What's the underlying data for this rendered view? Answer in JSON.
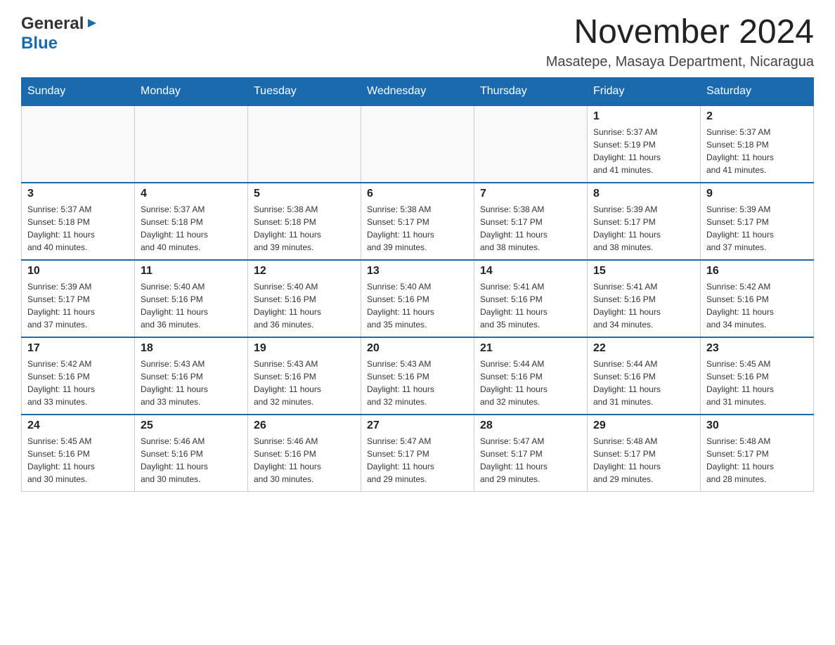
{
  "header": {
    "logo_general": "General",
    "logo_blue": "Blue",
    "title": "November 2024",
    "subtitle": "Masatepe, Masaya Department, Nicaragua"
  },
  "calendar": {
    "days_of_week": [
      "Sunday",
      "Monday",
      "Tuesday",
      "Wednesday",
      "Thursday",
      "Friday",
      "Saturday"
    ],
    "weeks": [
      [
        {
          "day": "",
          "info": ""
        },
        {
          "day": "",
          "info": ""
        },
        {
          "day": "",
          "info": ""
        },
        {
          "day": "",
          "info": ""
        },
        {
          "day": "",
          "info": ""
        },
        {
          "day": "1",
          "info": "Sunrise: 5:37 AM\nSunset: 5:19 PM\nDaylight: 11 hours\nand 41 minutes."
        },
        {
          "day": "2",
          "info": "Sunrise: 5:37 AM\nSunset: 5:18 PM\nDaylight: 11 hours\nand 41 minutes."
        }
      ],
      [
        {
          "day": "3",
          "info": "Sunrise: 5:37 AM\nSunset: 5:18 PM\nDaylight: 11 hours\nand 40 minutes."
        },
        {
          "day": "4",
          "info": "Sunrise: 5:37 AM\nSunset: 5:18 PM\nDaylight: 11 hours\nand 40 minutes."
        },
        {
          "day": "5",
          "info": "Sunrise: 5:38 AM\nSunset: 5:18 PM\nDaylight: 11 hours\nand 39 minutes."
        },
        {
          "day": "6",
          "info": "Sunrise: 5:38 AM\nSunset: 5:17 PM\nDaylight: 11 hours\nand 39 minutes."
        },
        {
          "day": "7",
          "info": "Sunrise: 5:38 AM\nSunset: 5:17 PM\nDaylight: 11 hours\nand 38 minutes."
        },
        {
          "day": "8",
          "info": "Sunrise: 5:39 AM\nSunset: 5:17 PM\nDaylight: 11 hours\nand 38 minutes."
        },
        {
          "day": "9",
          "info": "Sunrise: 5:39 AM\nSunset: 5:17 PM\nDaylight: 11 hours\nand 37 minutes."
        }
      ],
      [
        {
          "day": "10",
          "info": "Sunrise: 5:39 AM\nSunset: 5:17 PM\nDaylight: 11 hours\nand 37 minutes."
        },
        {
          "day": "11",
          "info": "Sunrise: 5:40 AM\nSunset: 5:16 PM\nDaylight: 11 hours\nand 36 minutes."
        },
        {
          "day": "12",
          "info": "Sunrise: 5:40 AM\nSunset: 5:16 PM\nDaylight: 11 hours\nand 36 minutes."
        },
        {
          "day": "13",
          "info": "Sunrise: 5:40 AM\nSunset: 5:16 PM\nDaylight: 11 hours\nand 35 minutes."
        },
        {
          "day": "14",
          "info": "Sunrise: 5:41 AM\nSunset: 5:16 PM\nDaylight: 11 hours\nand 35 minutes."
        },
        {
          "day": "15",
          "info": "Sunrise: 5:41 AM\nSunset: 5:16 PM\nDaylight: 11 hours\nand 34 minutes."
        },
        {
          "day": "16",
          "info": "Sunrise: 5:42 AM\nSunset: 5:16 PM\nDaylight: 11 hours\nand 34 minutes."
        }
      ],
      [
        {
          "day": "17",
          "info": "Sunrise: 5:42 AM\nSunset: 5:16 PM\nDaylight: 11 hours\nand 33 minutes."
        },
        {
          "day": "18",
          "info": "Sunrise: 5:43 AM\nSunset: 5:16 PM\nDaylight: 11 hours\nand 33 minutes."
        },
        {
          "day": "19",
          "info": "Sunrise: 5:43 AM\nSunset: 5:16 PM\nDaylight: 11 hours\nand 32 minutes."
        },
        {
          "day": "20",
          "info": "Sunrise: 5:43 AM\nSunset: 5:16 PM\nDaylight: 11 hours\nand 32 minutes."
        },
        {
          "day": "21",
          "info": "Sunrise: 5:44 AM\nSunset: 5:16 PM\nDaylight: 11 hours\nand 32 minutes."
        },
        {
          "day": "22",
          "info": "Sunrise: 5:44 AM\nSunset: 5:16 PM\nDaylight: 11 hours\nand 31 minutes."
        },
        {
          "day": "23",
          "info": "Sunrise: 5:45 AM\nSunset: 5:16 PM\nDaylight: 11 hours\nand 31 minutes."
        }
      ],
      [
        {
          "day": "24",
          "info": "Sunrise: 5:45 AM\nSunset: 5:16 PM\nDaylight: 11 hours\nand 30 minutes."
        },
        {
          "day": "25",
          "info": "Sunrise: 5:46 AM\nSunset: 5:16 PM\nDaylight: 11 hours\nand 30 minutes."
        },
        {
          "day": "26",
          "info": "Sunrise: 5:46 AM\nSunset: 5:16 PM\nDaylight: 11 hours\nand 30 minutes."
        },
        {
          "day": "27",
          "info": "Sunrise: 5:47 AM\nSunset: 5:17 PM\nDaylight: 11 hours\nand 29 minutes."
        },
        {
          "day": "28",
          "info": "Sunrise: 5:47 AM\nSunset: 5:17 PM\nDaylight: 11 hours\nand 29 minutes."
        },
        {
          "day": "29",
          "info": "Sunrise: 5:48 AM\nSunset: 5:17 PM\nDaylight: 11 hours\nand 29 minutes."
        },
        {
          "day": "30",
          "info": "Sunrise: 5:48 AM\nSunset: 5:17 PM\nDaylight: 11 hours\nand 28 minutes."
        }
      ]
    ]
  }
}
